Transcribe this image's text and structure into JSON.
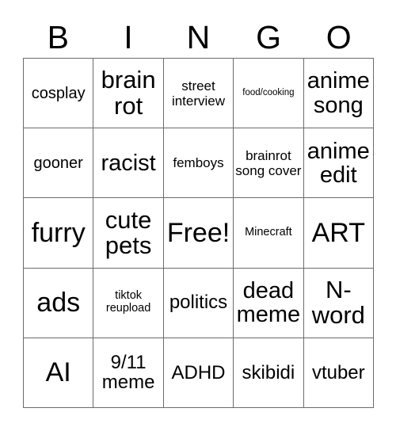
{
  "card": {
    "title": "BINGO",
    "header_letters": [
      "B",
      "I",
      "N",
      "G",
      "O"
    ],
    "free_space_label": "Free!",
    "colors": {
      "background": "#ffffff",
      "border": "#6b6b6b",
      "text": "#000000"
    },
    "rows": [
      [
        {
          "label": "cosplay",
          "size": "lg"
        },
        {
          "label": "brain rot",
          "size": "3xl"
        },
        {
          "label": "street interview",
          "size": "md"
        },
        {
          "label": "food/cooking",
          "size": "xs"
        },
        {
          "label": "anime song",
          "size": "2xl"
        }
      ],
      [
        {
          "label": "gooner",
          "size": "lg"
        },
        {
          "label": "racist",
          "size": "2xl"
        },
        {
          "label": "femboys",
          "size": "md"
        },
        {
          "label": "brainrot song cover",
          "size": "md"
        },
        {
          "label": "anime edit",
          "size": "2xl"
        }
      ],
      [
        {
          "label": "furry",
          "size": "4xl"
        },
        {
          "label": "cute pets",
          "size": "3xl"
        },
        {
          "label": "Free!",
          "size": "4xl"
        },
        {
          "label": "Minecraft",
          "size": "sm"
        },
        {
          "label": "ART",
          "size": "4xl"
        }
      ],
      [
        {
          "label": "ads",
          "size": "4xl"
        },
        {
          "label": "tiktok reupload",
          "size": "sm"
        },
        {
          "label": "politics",
          "size": "xl"
        },
        {
          "label": "dead meme",
          "size": "2xl"
        },
        {
          "label": "N-word",
          "size": "3xl"
        }
      ],
      [
        {
          "label": "AI",
          "size": "4xl"
        },
        {
          "label": "9/11 meme",
          "size": "xl"
        },
        {
          "label": "ADHD",
          "size": "xl"
        },
        {
          "label": "skibidi",
          "size": "xl"
        },
        {
          "label": "vtuber",
          "size": "xl"
        }
      ]
    ]
  }
}
